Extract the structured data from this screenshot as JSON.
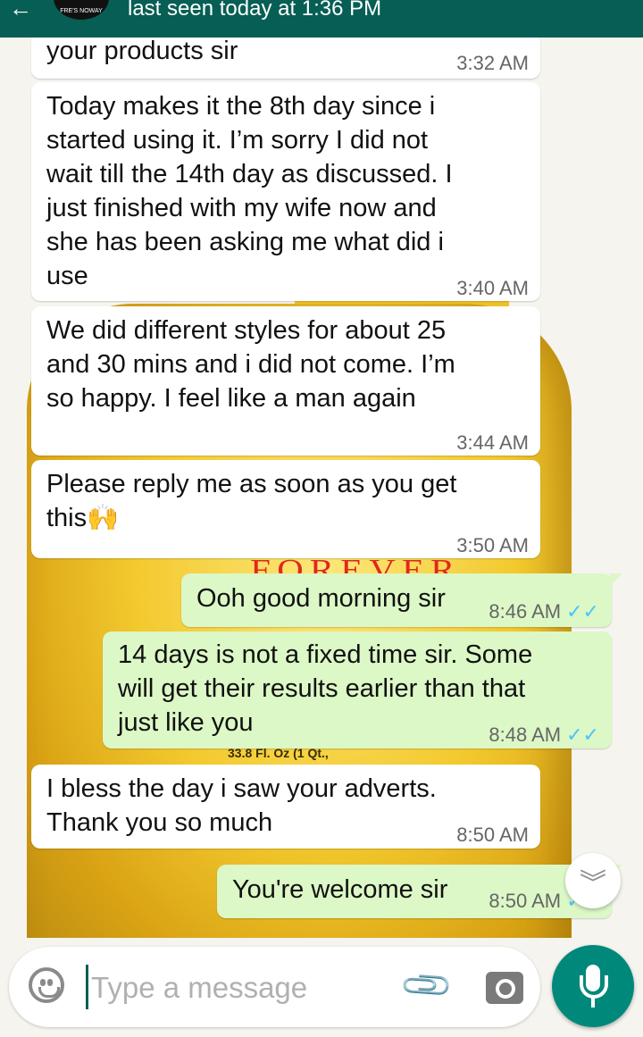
{
  "header": {
    "status": "last seen today at 1:36 PM",
    "avatar_text": "FRE'S NOWAY CREATE'S"
  },
  "wallpaper": {
    "brand": "FOREVER",
    "volume": "33.8 Fl. Oz (1 Qt.,"
  },
  "messages": [
    {
      "direction": "in",
      "text": "your products sir",
      "time": "3:32 AM"
    },
    {
      "direction": "in",
      "text": "Today makes it the 8th day since i\nstarted using it. I’m sorry I did not\nwait till the 14th day as discussed. I\njust finished with my wife now and\nshe has been asking me what did i\nuse",
      "time": "3:40 AM"
    },
    {
      "direction": "in",
      "text": "We did different styles for about 25\nand 30 mins and i did not come. I’m\nso happy. I feel like a man again",
      "time": "3:44 AM"
    },
    {
      "direction": "in",
      "text": "Please reply me as soon as you get\nthis🙌",
      "time": "3:50 AM"
    },
    {
      "direction": "out",
      "text": "Ooh good morning sir",
      "time": "8:46 AM",
      "ticks": "✓✓"
    },
    {
      "direction": "out",
      "text": "14 days is not a fixed time sir. Some\nwill get their results earlier than that\njust like you",
      "time": "8:48 AM",
      "ticks": "✓✓"
    },
    {
      "direction": "in",
      "text": "I bless the day i saw your adverts.\nThank you so much",
      "time": "8:50 AM"
    },
    {
      "direction": "out",
      "text": "You're welcome sir",
      "time": "8:50 AM",
      "ticks": "✓✓"
    }
  ],
  "input": {
    "placeholder": "Type a message"
  },
  "icons": {
    "emoji": "emoji-icon",
    "attach": "paperclip-icon",
    "camera": "camera-icon",
    "mic": "mic-icon",
    "scroll": "double-chevron-down-icon"
  },
  "colors": {
    "header": "#075e54",
    "outgoing_bubble": "#dcf8c6",
    "incoming_bubble": "#ffffff",
    "read_ticks": "#4fc3f7",
    "mic_button": "#00897b"
  }
}
